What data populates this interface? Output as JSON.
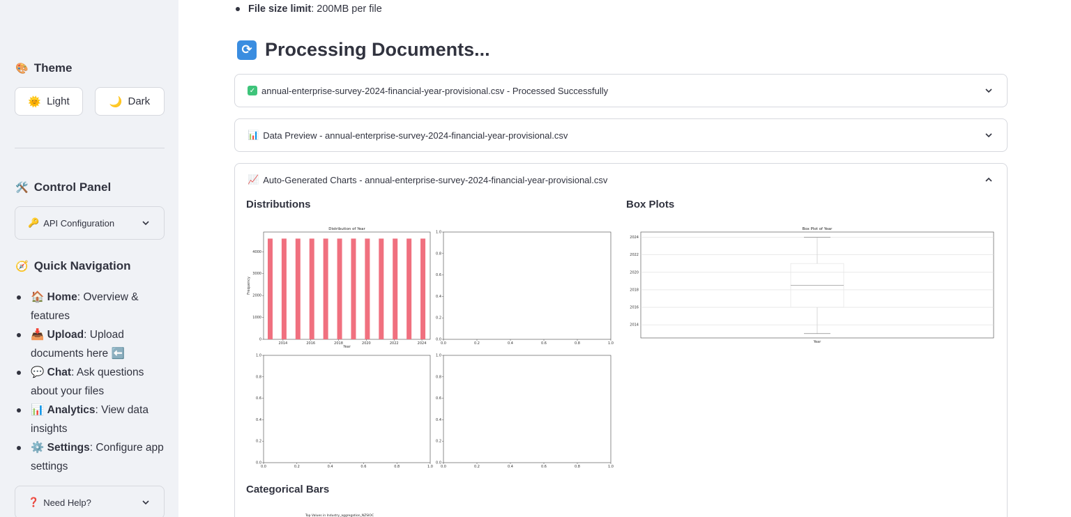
{
  "sidebar": {
    "theme_heading": "Theme",
    "theme_buttons": {
      "light": "Light",
      "dark": "Dark"
    },
    "control_heading": "Control Panel",
    "api_config": "API Configuration",
    "nav_heading": "Quick Navigation",
    "nav_items": [
      {
        "label": "Home",
        "desc": ": Overview & features",
        "icon": "house-icon"
      },
      {
        "label": "Upload",
        "desc": ": Upload documents here",
        "icon": "inbox-tray-icon"
      },
      {
        "label": "Chat",
        "desc": ": Ask questions about your files",
        "icon": "speech-bubble-icon"
      },
      {
        "label": "Analytics",
        "desc": ": View data insights",
        "icon": "bar-chart-icon"
      },
      {
        "label": "Settings",
        "desc": ": Configure app settings",
        "icon": "gear-icon"
      }
    ],
    "help": "Need Help?"
  },
  "main": {
    "file_limit_label": "File size limit",
    "file_limit_value": ": 200MB per file",
    "title": "Processing Documents...",
    "expanders": [
      {
        "label": "annual-enterprise-survey-2024-financial-year-provisional.csv - Processed Successfully",
        "icon": "check-icon"
      },
      {
        "label": "Data Preview - annual-enterprise-survey-2024-financial-year-provisional.csv",
        "icon": "bar-chart-icon"
      },
      {
        "label": "Auto-Generated Charts - annual-enterprise-survey-2024-financial-year-provisional.csv",
        "icon": "chart-increasing-icon"
      }
    ],
    "sections": {
      "distributions": "Distributions",
      "box_plots": "Box Plots",
      "categorical": "Categorical Bars"
    }
  },
  "chart_data": [
    {
      "type": "bar",
      "title": "Distribution of Year",
      "xlabel": "Year",
      "ylabel": "Frequency",
      "x": [
        2013,
        2014,
        2015,
        2016,
        2017,
        2018,
        2019,
        2020,
        2021,
        2022,
        2023,
        2024
      ],
      "values": [
        4600,
        4600,
        4600,
        4600,
        4600,
        4600,
        4600,
        4600,
        4600,
        4600,
        4600,
        4600
      ],
      "xticks": [
        "2014",
        "2016",
        "2018",
        "2020",
        "2022",
        "2024"
      ],
      "yticks": [
        "0",
        "1000",
        "2000",
        "3000",
        "4000"
      ],
      "ylim": [
        0,
        4900
      ],
      "color": "#f0707f"
    },
    {
      "type": "scatter",
      "empty": true,
      "xticks": [
        "0.0",
        "0.2",
        "0.4",
        "0.6",
        "0.8",
        "1.0"
      ],
      "yticks": [
        "0.0",
        "0.2",
        "0.4",
        "0.6",
        "0.8",
        "1.0"
      ]
    },
    {
      "type": "scatter",
      "empty": true,
      "xticks": [
        "0.0",
        "0.2",
        "0.4",
        "0.6",
        "0.8",
        "1.0"
      ],
      "yticks": [
        "0.0",
        "0.2",
        "0.4",
        "0.6",
        "0.8",
        "1.0"
      ]
    },
    {
      "type": "scatter",
      "empty": true,
      "xticks": [
        "0.0",
        "0.2",
        "0.4",
        "0.6",
        "0.8",
        "1.0"
      ],
      "yticks": [
        "0.0",
        "0.2",
        "0.4",
        "0.6",
        "0.8",
        "1.0"
      ]
    },
    {
      "type": "box",
      "title": "Box Plot of Year",
      "xlabel": "Year",
      "min": 2013,
      "q1": 2016,
      "median": 2018.5,
      "q3": 2021,
      "max": 2024,
      "ylim": [
        2012.5,
        2024.6
      ],
      "yticks": [
        "2014",
        "2016",
        "2018",
        "2020",
        "2022",
        "2024"
      ]
    },
    {
      "type": "bar",
      "title": "Top Values in Industry_aggregation_NZSIOC"
    }
  ]
}
